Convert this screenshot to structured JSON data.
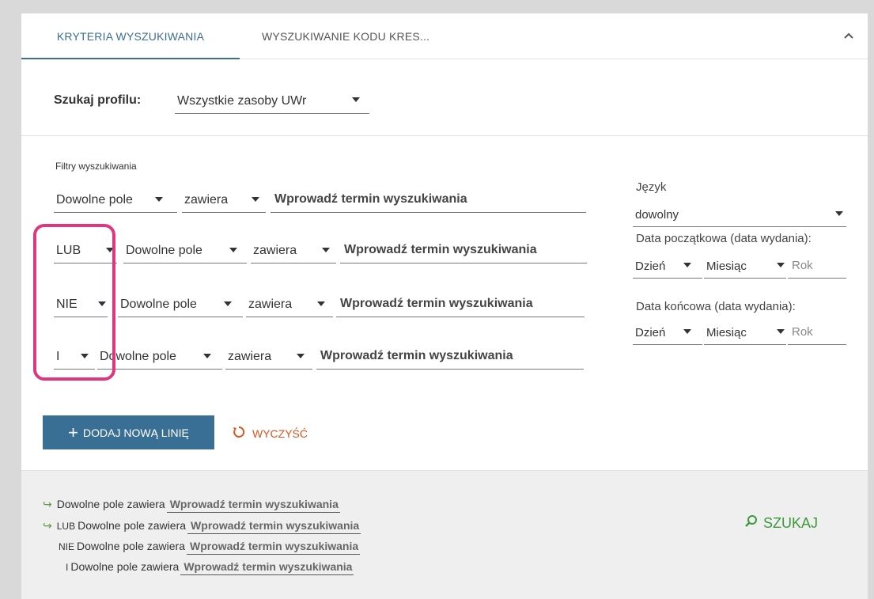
{
  "tabs": [
    {
      "label": "KRYTERIA WYSZUKIWANIA"
    },
    {
      "label": "WYSZUKIWANIE KODU KRES..."
    }
  ],
  "profile": {
    "label": "Szukaj profilu:",
    "value": "Wszystkie zasoby UWr"
  },
  "filters": {
    "label": "Filtry wyszukiwania",
    "rows": [
      {
        "operator": "",
        "field": "Dowolne pole",
        "condition": "zawiera",
        "term_placeholder": "Wprowadź termin wyszukiwania"
      },
      {
        "operator": "LUB",
        "field": "Dowolne pole",
        "condition": "zawiera",
        "term_placeholder": "Wprowadź termin wyszukiwania"
      },
      {
        "operator": "NIE",
        "field": "Dowolne pole",
        "condition": "zawiera",
        "term_placeholder": "Wprowadź termin wyszukiwania"
      },
      {
        "operator": "I",
        "field": "Dowolne pole",
        "condition": "zawiera",
        "term_placeholder": "Wprowadź termin wyszukiwania"
      }
    ]
  },
  "side": {
    "language_label": "Język",
    "language_value": "dowolny",
    "start_date_label": "Data początkowa (data wydania):",
    "end_date_label": "Data końcowa (data wydania):",
    "day": "Dzień",
    "month": "Miesiąc",
    "year": "Rok"
  },
  "buttons": {
    "add_line": "DODAJ NOWĄ LINIĘ",
    "clear": "WYCZYŚĆ",
    "search": "SZUKAJ"
  },
  "summary": [
    {
      "operator": "",
      "text": "Dowolne pole zawiera",
      "term": "Wprowadź termin wyszukiwania"
    },
    {
      "operator": "LUB",
      "text": "Dowolne pole zawiera",
      "term": "Wprowadź termin wyszukiwania"
    },
    {
      "operator": "NIE",
      "text": "Dowolne pole zawiera",
      "term": "Wprowadź termin wyszukiwania"
    },
    {
      "operator": "I",
      "text": "Dowolne pole zawiera",
      "term": "Wprowadź termin wyszukiwania"
    }
  ],
  "colors": {
    "accent": "#3a6f95",
    "highlight": "#e0367f",
    "clear": "#d9541e",
    "search": "#3a9a3a"
  }
}
